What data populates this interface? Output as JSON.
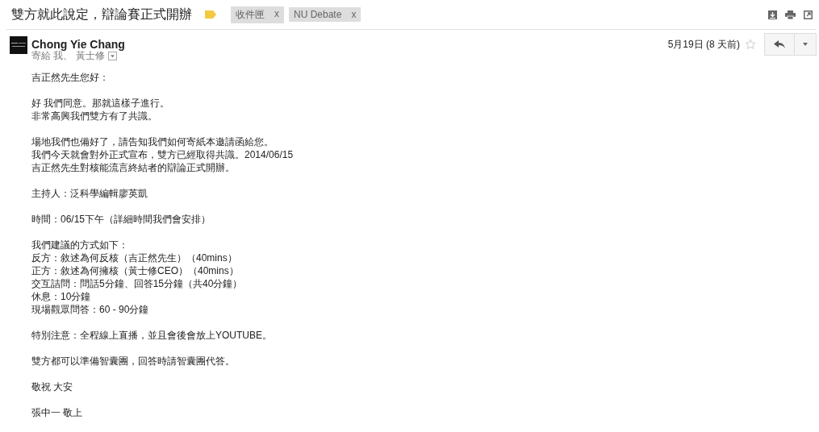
{
  "subject": "雙方就此說定，辯論賽正式開辦",
  "labels": [
    {
      "text": "收件匣",
      "remove": "x"
    },
    {
      "text": "NU Debate",
      "remove": "x"
    }
  ],
  "message": {
    "sender": "Chong Yie Chang",
    "recipients": "寄給 我、 黃士修",
    "date": "5月19日 (8 天前)",
    "starred": false,
    "paragraphs": [
      [
        "吉正然先生您好："
      ],
      [
        "好 我們同意。那就這樣子進行。",
        "非常高興我們雙方有了共識。"
      ],
      [
        "場地我們也備好了，請告知我們如何寄紙本邀請函給您。",
        "我們今天就會對外正式宣布，雙方已經取得共識。2014/06/15",
        "吉正然先生對核能流言終結者的辯論正式開辦。"
      ],
      [
        "主持人：泛科學編輯廖英凱"
      ],
      [
        "時間：06/15下午（詳細時間我們會安排）"
      ],
      [
        "我們建議的方式如下：",
        "反方：敘述為何反核（吉正然先生）（40mins）",
        "正方：敘述為何擁核（黃士修CEO）（40mins）",
        "交互詰問：問話5分鐘、回答15分鐘（共40分鐘）",
        "休息：10分鐘",
        "現場觀眾問答：60 - 90分鐘"
      ],
      [
        "特別注意：全程線上直播，並且會後會放上YOUTUBE。"
      ],
      [
        "雙方都可以準備智囊團，回答時請智囊團代答。"
      ],
      [
        "敬祝 大安"
      ],
      [
        "張中一 敬上"
      ]
    ]
  }
}
